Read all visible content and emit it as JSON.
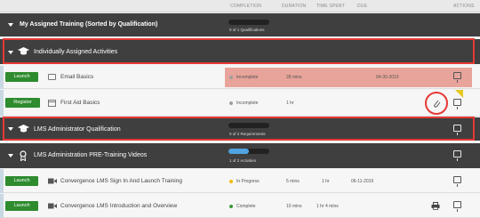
{
  "columns": {
    "completion": "COMPLETION",
    "duration": "DURATION",
    "time_spent": "TIME SPENT",
    "due": "DUE",
    "actions": "ACTIONS"
  },
  "section_main": {
    "title": "My Assigned Training (Sorted by Qualification)",
    "progress_text": "0 of 1 Qualifications",
    "progress_fraction": 0
  },
  "group_individual": {
    "title": "Individually Assigned Activities",
    "icon": "graduation-cap-icon"
  },
  "items_individual": [
    {
      "button": "Launch",
      "icon": "web-page-icon",
      "name": "Email Basics",
      "status": "Incomplete",
      "duration": "28 mins",
      "time_spent": "",
      "due": "04-30-2019",
      "status_color": "#9e9e9e",
      "overdue": true
    },
    {
      "button": "Register",
      "icon": "calendar-icon",
      "name": "First Aid Basics",
      "status": "Incomplete",
      "duration": "1 hr",
      "time_spent": "",
      "due": "",
      "status_color": "#9e9e9e",
      "overdue": false
    }
  ],
  "group_lms_admin": {
    "title": "LMS Administrator Qualification",
    "icon": "graduation-cap-icon",
    "progress_text": "0 of 2 Requirements",
    "progress_fraction": 0
  },
  "group_pre_training": {
    "title": "LMS Administration PRE-Training Videos",
    "icon": "award-ribbon-icon",
    "progress_text": "1 of 2 Activities",
    "progress_fraction": 0.5
  },
  "items_videos": [
    {
      "button": "Launch",
      "icon": "video-camera-icon",
      "name": "Convergence LMS Sign In And Launch Training",
      "status": "In Progress",
      "duration": "5 mins",
      "time_spent": "1 hr",
      "due": "06-11-2019",
      "status_color": "#f5b800"
    },
    {
      "button": "Launch",
      "icon": "video-camera-icon",
      "name": "Convergence LMS Introduction and Overview",
      "status": "Complete",
      "duration": "10 mins",
      "time_spent": "1 hr 4 mins",
      "due": "",
      "status_color": "#3a9a3a"
    }
  ],
  "colors": {
    "group_bg": "#3f3f3f",
    "launch_green": "#2e8b2e",
    "highlight_red": "#e53935",
    "overdue_bg": "#e8a49a",
    "progress_blue": "#4fa3e0"
  }
}
